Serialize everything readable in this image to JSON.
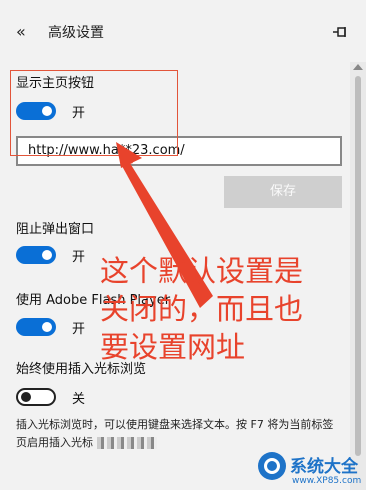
{
  "header": {
    "back_glyph": "«",
    "title": "高级设置",
    "pin_icon": "pin-icon"
  },
  "home_button": {
    "label": "显示主页按钮",
    "state": "开",
    "url_value": "http://www.ha**23.com/",
    "save_label": "保存"
  },
  "popup_blocker": {
    "label": "阻止弹出窗口",
    "state": "开"
  },
  "flash": {
    "label": "使用 Adobe Flash Player",
    "state": "开"
  },
  "caret_browsing": {
    "label": "始终使用插入光标浏览",
    "state": "关",
    "description": "插入光标浏览时，可以使用键盘来选择文本。按 F7 将为当前标签页启用插入光标"
  },
  "annotation": {
    "lines": [
      "这个默认设置是",
      "关闭的，而且也",
      "要设置网址"
    ],
    "color": "#e8432c"
  },
  "watermark": {
    "name": "系统大全",
    "url": "www.XP85.com"
  },
  "colors": {
    "accent": "#0a6fd6",
    "background": "#f2f2f2"
  }
}
